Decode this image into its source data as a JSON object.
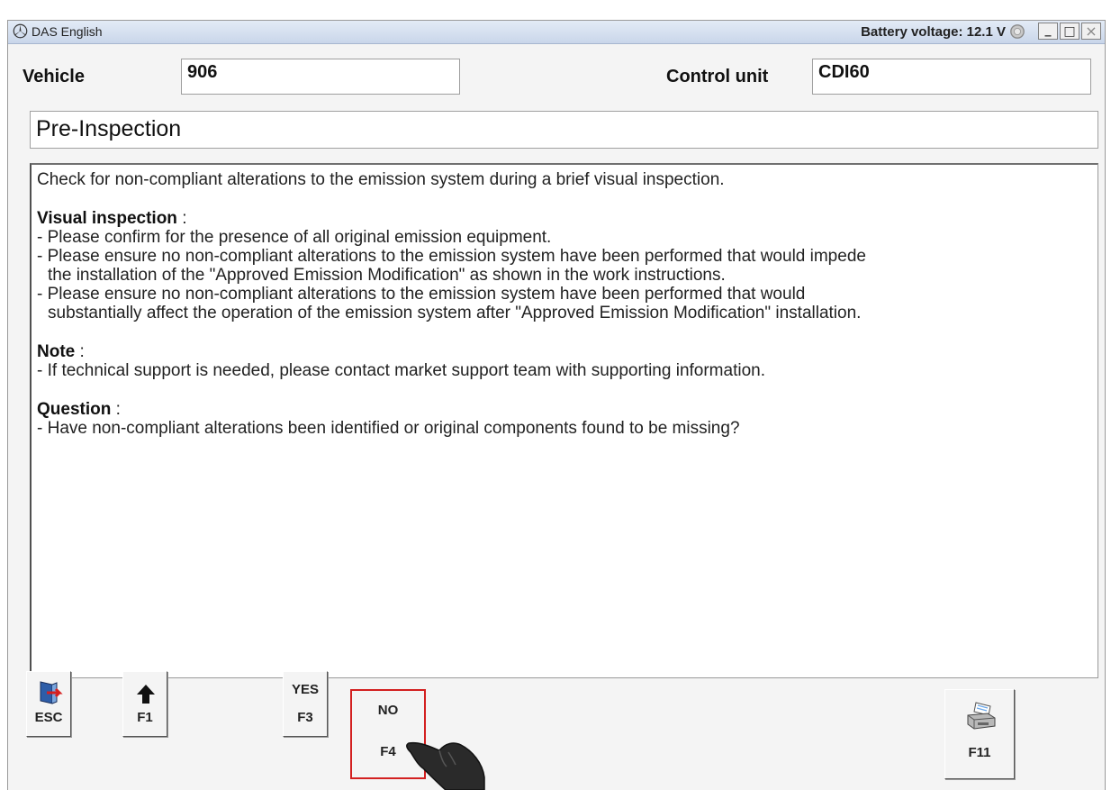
{
  "window": {
    "app_title": "DAS English",
    "battery_voltage": "Battery voltage: 12.1 V",
    "controls": {
      "minimize": "_",
      "maximize": "□",
      "close": "×"
    }
  },
  "header": {
    "vehicle_label": "Vehicle",
    "vehicle_value": "906",
    "control_unit_label": "Control unit",
    "control_unit_value": "CDI60"
  },
  "page_title": "Pre-Inspection",
  "content": {
    "intro": "Check for non-compliant alterations to the emission system during a brief visual inspection.",
    "visual_heading": "Visual inspection",
    "visual_items": [
      "- Please confirm for the presence of all original emission equipment.",
      "- Please ensure no non-compliant alterations to the emission system have been performed that would impede",
      "the installation of the \"Approved Emission Modification\" as shown in the work instructions.",
      "- Please ensure no non-compliant alterations to the emission system have been performed that would",
      "substantially affect the operation of the emission system after \"Approved Emission Modification\" installation."
    ],
    "note_heading": "Note",
    "note_items": [
      "- If technical support is needed, please contact market support team with supporting information."
    ],
    "question_heading": "Question",
    "question_items": [
      "- Have non-compliant alterations been identified or original components found to be missing?"
    ],
    "colon": " :"
  },
  "function_keys": {
    "esc": {
      "label": "ESC",
      "icon": "exit-door-icon"
    },
    "f1": {
      "label": "F1",
      "icon": "up-arrow-icon"
    },
    "f3": {
      "top": "YES",
      "label": "F3"
    },
    "f4": {
      "top": "NO",
      "label": "F4",
      "selected": true
    },
    "f11": {
      "label": "F11",
      "icon": "printer-icon"
    }
  },
  "colors": {
    "titlebar": "#c9d6ea",
    "selected_border": "#d32020",
    "background": "#f4f4f4"
  }
}
